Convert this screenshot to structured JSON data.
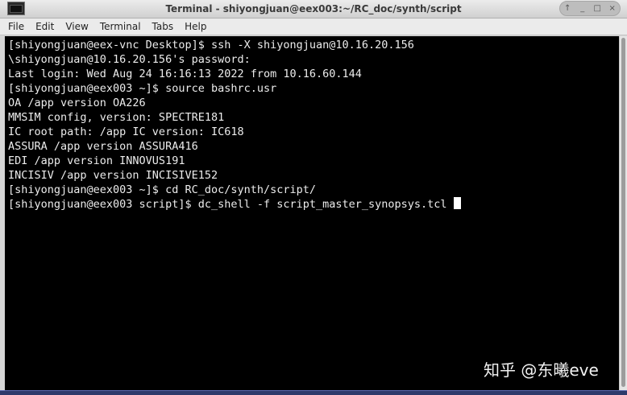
{
  "window": {
    "title": "Terminal - shiyongjuan@eex003:~/RC_doc/synth/script",
    "controls": [
      "↑",
      "_",
      "□",
      "×"
    ]
  },
  "menu": [
    "File",
    "Edit",
    "View",
    "Terminal",
    "Tabs",
    "Help"
  ],
  "terminal": {
    "lines": [
      "[shiyongjuan@eex-vnc Desktop]$ ssh -X shiyongjuan@10.16.20.156",
      "\\shiyongjuan@10.16.20.156's password:",
      "Last login: Wed Aug 24 16:16:13 2022 from 10.16.60.144",
      "[shiyongjuan@eex003 ~]$ source bashrc.usr",
      "OA /app version OA226",
      "MMSIM config, version: SPECTRE181",
      "IC root path: /app IC version: IC618",
      "ASSURA /app version ASSURA416",
      "EDI /app version INNOVUS191",
      "INCISIV /app version INCISIVE152",
      "[shiyongjuan@eex003 ~]$ cd RC_doc/synth/script/",
      "[shiyongjuan@eex003 script]$ dc_shell -f script_master_synopsys.tcl "
    ],
    "background": "#000000",
    "foreground": "#ececec"
  },
  "watermark": "知乎 @东曦eve",
  "icons": {
    "app": "terminal-icon"
  }
}
